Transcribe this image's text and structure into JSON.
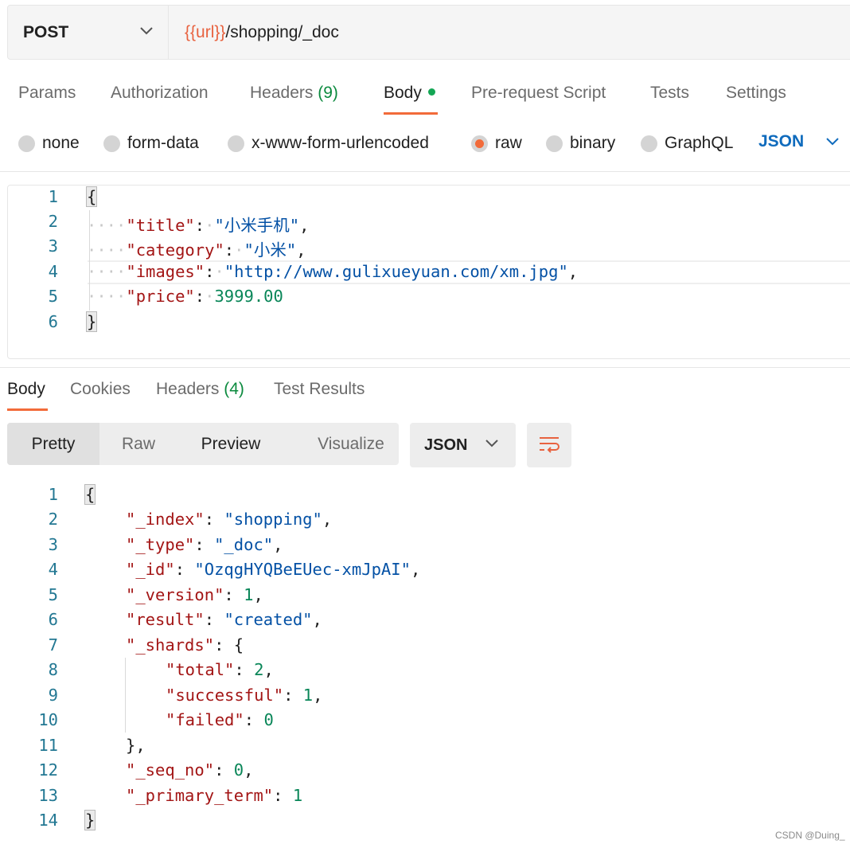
{
  "request": {
    "method": "POST",
    "url_var": "{{url}}",
    "url_path": "/shopping/_doc"
  },
  "tabs": [
    {
      "label": "Params"
    },
    {
      "label": "Authorization"
    },
    {
      "label": "Headers",
      "count": "(9)"
    },
    {
      "label": "Body",
      "active": true
    },
    {
      "label": "Pre-request Script"
    },
    {
      "label": "Tests"
    },
    {
      "label": "Settings"
    }
  ],
  "body_types": [
    {
      "label": "none"
    },
    {
      "label": "form-data"
    },
    {
      "label": "x-www-form-urlencoded"
    },
    {
      "label": "raw",
      "selected": true
    },
    {
      "label": "binary"
    },
    {
      "label": "GraphQL"
    }
  ],
  "raw_format": "JSON",
  "request_body": {
    "line_numbers": [
      "1",
      "2",
      "3",
      "4",
      "5",
      "6"
    ],
    "open_brace": "{",
    "close_brace": "}",
    "fields": [
      {
        "key": "\"title\"",
        "value": "\"小米手机\"",
        "type": "string",
        "comma": ","
      },
      {
        "key": "\"category\"",
        "value": "\"小米\"",
        "type": "string",
        "comma": ","
      },
      {
        "key": "\"images\"",
        "value": "\"http://www.gulixueyuan.com/xm.jpg\"",
        "type": "string",
        "comma": ","
      },
      {
        "key": "\"price\"",
        "value": "3999.00",
        "type": "number",
        "comma": ""
      }
    ]
  },
  "response_tabs": [
    {
      "label": "Body",
      "active": true
    },
    {
      "label": "Cookies"
    },
    {
      "label": "Headers",
      "count": "(4)"
    },
    {
      "label": "Test Results"
    }
  ],
  "view_modes": [
    "Pretty",
    "Raw",
    "Preview",
    "Visualize"
  ],
  "response_format": "JSON",
  "response_body": {
    "line_numbers": [
      "1",
      "2",
      "3",
      "4",
      "5",
      "6",
      "7",
      "8",
      "9",
      "10",
      "11",
      "12",
      "13",
      "14"
    ],
    "open_brace": "{",
    "close_brace": "}",
    "lines": [
      {
        "key": "\"_index\"",
        "value": "\"shopping\"",
        "type": "string",
        "comma": ","
      },
      {
        "key": "\"_type\"",
        "value": "\"_doc\"",
        "type": "string",
        "comma": ","
      },
      {
        "key": "\"_id\"",
        "value": "\"OzqgHYQBeEUec-xmJpAI\"",
        "type": "string",
        "comma": ","
      },
      {
        "key": "\"_version\"",
        "value": "1",
        "type": "number",
        "comma": ","
      },
      {
        "key": "\"result\"",
        "value": "\"created\"",
        "type": "string",
        "comma": ","
      },
      {
        "key": "\"_shards\"",
        "value": "{",
        "type": "punct",
        "comma": ""
      },
      {
        "key": "\"total\"",
        "value": "2",
        "type": "number",
        "comma": ",",
        "indent": 2
      },
      {
        "key": "\"successful\"",
        "value": "1",
        "type": "number",
        "comma": ",",
        "indent": 2
      },
      {
        "key": "\"failed\"",
        "value": "0",
        "type": "number",
        "comma": "",
        "indent": 2
      },
      {
        "key": "",
        "value": "}",
        "type": "punct",
        "comma": ","
      },
      {
        "key": "\"_seq_no\"",
        "value": "0",
        "type": "number",
        "comma": ","
      },
      {
        "key": "\"_primary_term\"",
        "value": "1",
        "type": "number",
        "comma": ""
      }
    ]
  },
  "watermark": "CSDN @Duing_",
  "colors": {
    "accent": "#f26b3a",
    "url_var": "#e8623f",
    "json_key": "#a31515",
    "json_string": "#0451a5",
    "json_number": "#098658",
    "line_number": "#237893",
    "count_green": "#0b8a3e",
    "dropdown_blue": "#0f6bbd"
  }
}
